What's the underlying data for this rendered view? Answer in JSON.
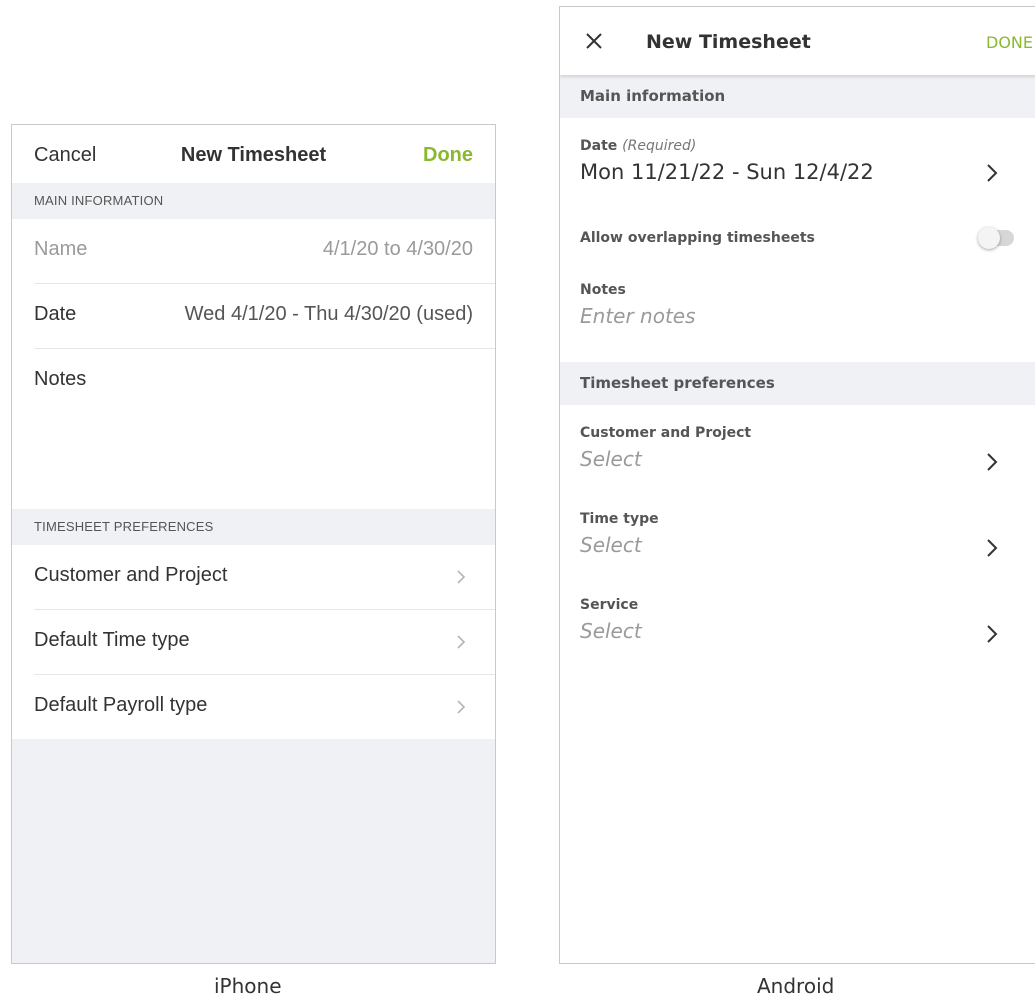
{
  "iphone": {
    "nav": {
      "cancel": "Cancel",
      "title": "New Timesheet",
      "done": "Done"
    },
    "main_section": "MAIN INFORMATION",
    "name_label": "Name",
    "name_value": "4/1/20 to 4/30/20",
    "date_label": "Date",
    "date_value": "Wed 4/1/20 - Thu 4/30/20 (used)",
    "notes_label": "Notes",
    "prefs_section": "TIMESHEET PREFERENCES",
    "prefs": [
      {
        "label": "Customer and Project"
      },
      {
        "label": "Default Time type"
      },
      {
        "label": "Default Payroll type"
      }
    ],
    "caption": "iPhone"
  },
  "android": {
    "toolbar": {
      "title": "New Timesheet",
      "done": "DONE"
    },
    "main_section": "Main information",
    "date_label": "Date",
    "date_required": "(Required)",
    "date_value": "Mon 11/21/22 - Sun 12/4/22",
    "overlap_label": "Allow overlapping timesheets",
    "overlap_enabled": false,
    "notes_label": "Notes",
    "notes_placeholder": "Enter notes",
    "prefs_section": "Timesheet preferences",
    "prefs": [
      {
        "label": "Customer and Project",
        "value": "Select"
      },
      {
        "label": "Time type",
        "value": "Select"
      },
      {
        "label": "Service",
        "value": "Select"
      }
    ],
    "caption": "Android"
  },
  "colors": {
    "accent": "#8ab82f",
    "section_bg": "#eff1f4"
  }
}
